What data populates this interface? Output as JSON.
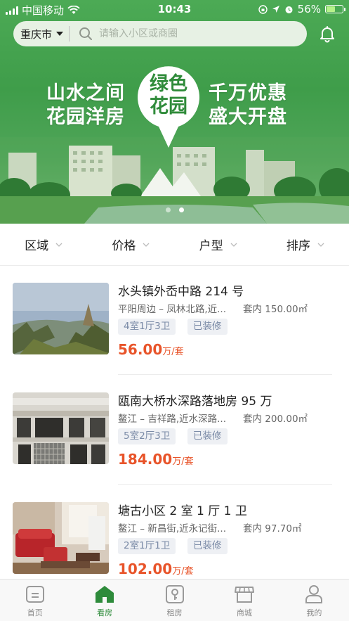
{
  "status_bar": {
    "carrier": "中国移动",
    "time": "10:43",
    "battery": "56%",
    "battery_level": 0.56
  },
  "header": {
    "city": "重庆市",
    "search_placeholder": "请输入小区或商圈"
  },
  "banner": {
    "slogan_left": [
      "山水之间",
      "花园洋房"
    ],
    "pin_text": [
      "绿色",
      "花园"
    ],
    "slogan_right": [
      "千万优惠",
      "盛大开盘"
    ],
    "slides": 2,
    "active_slide": 2
  },
  "filters": [
    "区域",
    "价格",
    "户型",
    "排序"
  ],
  "listings": [
    {
      "title": "水头镇外岙中路 214 号",
      "location": "平阳周边 – 凤林北路,近...",
      "area": "套内 150.00㎡",
      "tags": [
        "4室1厅3卫",
        "已装修"
      ],
      "price": "56.00",
      "unit": "万/套"
    },
    {
      "title": "瓯南大桥水深路落地房 95 万",
      "location": "鳌江 – 吉祥路,近水深路...",
      "area": "套内 200.00㎡",
      "tags": [
        "5室2厅3卫",
        "已装修"
      ],
      "price": "184.00",
      "unit": "万/套"
    },
    {
      "title": "塘古小区 2 室 1 厅 1 卫",
      "location": "鳌江 – 新昌街,近永记街...",
      "area": "套内 97.70㎡",
      "tags": [
        "2室1厅1卫",
        "已装修"
      ],
      "price": "102.00",
      "unit": "万/套"
    }
  ],
  "tabbar": {
    "items": [
      {
        "label": "首页",
        "icon": "home-doc-icon",
        "active": false
      },
      {
        "label": "看房",
        "icon": "house-icon",
        "active": true
      },
      {
        "label": "租房",
        "icon": "key-icon",
        "active": false
      },
      {
        "label": "商城",
        "icon": "store-icon",
        "active": false
      },
      {
        "label": "我的",
        "icon": "person-icon",
        "active": false
      }
    ]
  },
  "colors": {
    "brand_green": "#2e8b3b",
    "price_orange": "#e8542a",
    "tag_text": "#7a8aa6"
  }
}
